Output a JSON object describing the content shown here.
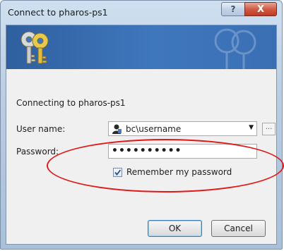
{
  "window": {
    "title": "Connect to pharos-ps1",
    "help_glyph": "?",
    "close_glyph": "X"
  },
  "dialog": {
    "connecting_text": "Connecting to pharos-ps1",
    "username_label": "User name:",
    "username_value": "bc\\username",
    "password_label": "Password:",
    "password_value": "••••••••••",
    "browse_label": "...",
    "remember_label": "Remember my password",
    "remember_checked": true,
    "ok_label": "OK",
    "cancel_label": "Cancel"
  },
  "icons": {
    "banner": "keys-icon",
    "user": "user-icon",
    "dropdown": "chevron-down-icon"
  },
  "colors": {
    "annotation": "#e01818",
    "banner": "#3f77bd"
  }
}
